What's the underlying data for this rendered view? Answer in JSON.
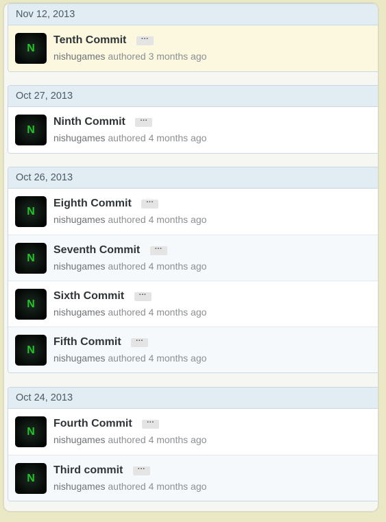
{
  "groups": [
    {
      "date": "Nov 12, 2013",
      "commits": [
        {
          "title": "Tenth Commit",
          "author": "nishugames",
          "authored": "authored",
          "time": "3 months ago",
          "avatar_letter": "N",
          "more": "···"
        }
      ]
    },
    {
      "date": "Oct 27, 2013",
      "commits": [
        {
          "title": "Ninth Commit",
          "author": "nishugames",
          "authored": "authored",
          "time": "4 months ago",
          "avatar_letter": "N",
          "more": "···"
        }
      ]
    },
    {
      "date": "Oct 26, 2013",
      "commits": [
        {
          "title": "Eighth Commit",
          "author": "nishugames",
          "authored": "authored",
          "time": "4 months ago",
          "avatar_letter": "N",
          "more": "···"
        },
        {
          "title": "Seventh Commit",
          "author": "nishugames",
          "authored": "authored",
          "time": "4 months ago",
          "avatar_letter": "N",
          "more": "···"
        },
        {
          "title": "Sixth Commit",
          "author": "nishugames",
          "authored": "authored",
          "time": "4 months ago",
          "avatar_letter": "N",
          "more": "···"
        },
        {
          "title": "Fifth Commit",
          "author": "nishugames",
          "authored": "authored",
          "time": "4 months ago",
          "avatar_letter": "N",
          "more": "···"
        }
      ]
    },
    {
      "date": "Oct 24, 2013",
      "commits": [
        {
          "title": "Fourth Commit",
          "author": "nishugames",
          "authored": "authored",
          "time": "4 months ago",
          "avatar_letter": "N",
          "more": "···"
        },
        {
          "title": "Third commit",
          "author": "nishugames",
          "authored": "authored",
          "time": "4 months ago",
          "avatar_letter": "N",
          "more": "···"
        }
      ]
    }
  ],
  "colors": {
    "page_background": "#ebe8c6",
    "header_background": "#e1edf3",
    "highlight_row": "#fbf8df",
    "avatar_letter": "#23c427"
  }
}
